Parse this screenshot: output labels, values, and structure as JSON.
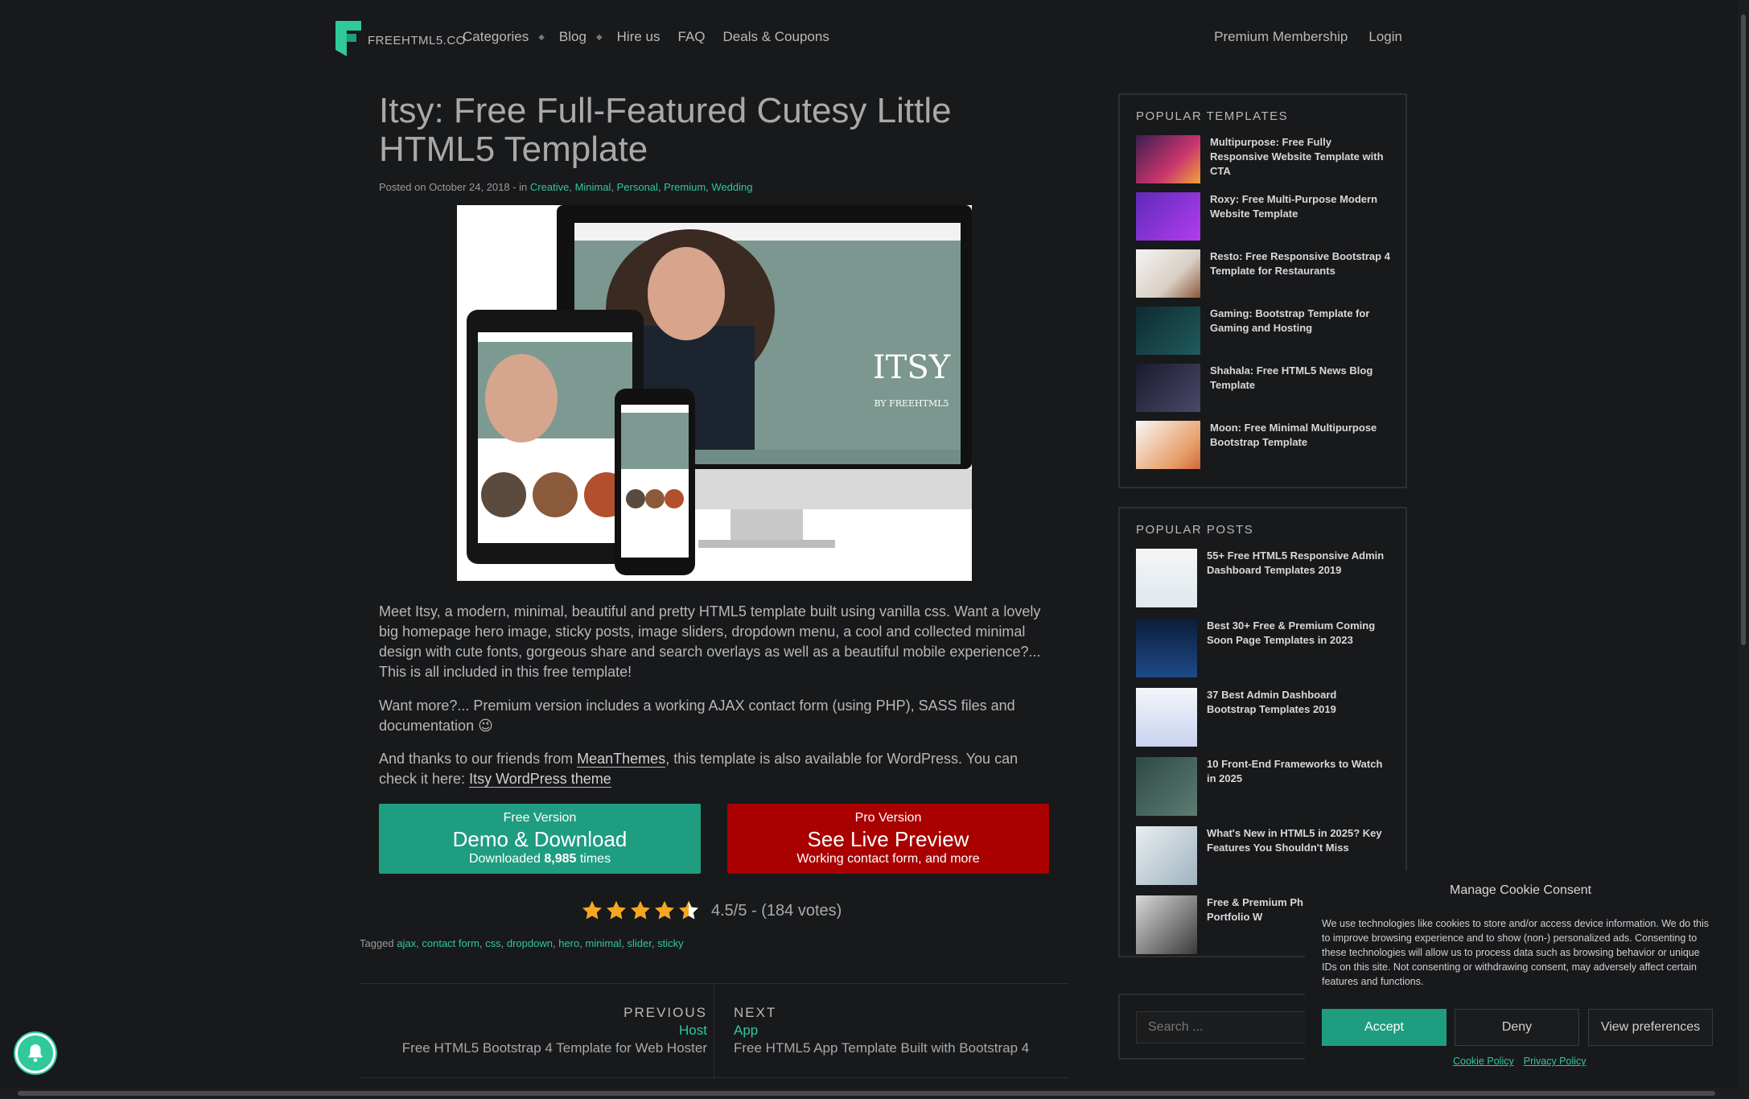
{
  "nav": {
    "logo_text": "FREEHTML5.CO",
    "links": [
      "Categories",
      "Blog",
      "Hire us",
      "FAQ",
      "Deals & Coupons"
    ],
    "right_links": [
      "Premium Membership",
      "Login"
    ]
  },
  "article": {
    "title": "Itsy: Free Full-Featured Cutesy Little HTML5 Template",
    "posted_prefix": "Posted on October 24, 2018 - in",
    "categories": [
      "Creative",
      "Minimal",
      "Personal",
      "Premium",
      "Wedding"
    ],
    "hero_brand": "ITSY",
    "hero_sub": "BY FREEHTML5",
    "p1": "Meet Itsy, a modern, minimal, beautiful and pretty HTML5 template built using vanilla css. Want a lovely big homepage hero image, sticky posts, image sliders, dropdown menu, a cool and collected minimal design with cute fonts, gorgeous share and search overlays as well as a beautiful mobile experience?... This is all included in this free template!",
    "p2": "Want more?... Premium version includes a working AJAX contact form (using PHP), SASS files and documentation 😉",
    "p3_a": "And thanks to our friends from ",
    "p3_link1": "MeanThemes",
    "p3_b": ", this template is also available for WordPress. You can check it here: ",
    "p3_link2": "Itsy WordPress theme"
  },
  "buttons": {
    "free": {
      "small": "Free Version",
      "big": "Demo & Download",
      "sub_prefix": "Downloaded ",
      "count": "8,985",
      "sub_suffix": " times"
    },
    "pro": {
      "small": "Pro Version",
      "big": "See Live Preview",
      "sub": "Working contact form, and more"
    }
  },
  "rating": {
    "stars": 4.5,
    "text": "4.5/5 - (184 votes)"
  },
  "tags": {
    "prefix": "Tagged",
    "items": [
      "ajax",
      "contact form",
      "css",
      "dropdown",
      "hero",
      "minimal",
      "slider",
      "sticky"
    ]
  },
  "post_nav": {
    "prev": {
      "label": "PREVIOUS",
      "category": "Host",
      "title": "Free HTML5 Bootstrap 4 Template for Web Hoster"
    },
    "next": {
      "label": "NEXT",
      "category": "App",
      "title": "Free HTML5 App Template Built with Bootstrap 4"
    }
  },
  "sidebar": {
    "templates_title": "POPULAR TEMPLATES",
    "templates": [
      "Multipurpose: Free Fully Responsive Website Template with CTA",
      "Roxy: Free Multi-Purpose Modern Website Template",
      "Resto: Free Responsive Bootstrap 4 Template for Restaurants",
      "Gaming: Bootstrap Template for Gaming and Hosting",
      "Shahala: Free HTML5 News Blog Template",
      "Moon: Free Minimal Multipurpose Bootstrap Template"
    ],
    "posts_title": "POPULAR POSTS",
    "posts": [
      "55+ Free HTML5 Responsive Admin Dashboard Templates 2019",
      "Best 30+ Free & Premium Coming Soon Page Templates in 2023",
      "37 Best Admin Dashboard Bootstrap Templates 2019",
      "10 Front-End Frameworks to Watch in 2025",
      "What's New in HTML5 in 2025? Key Features You Shouldn't Miss",
      "Free & Premium Ph Creative Portfolio W"
    ],
    "search_placeholder": "Search ..."
  },
  "cookie": {
    "title": "Manage Cookie Consent",
    "text": "We use technologies like cookies to store and/or access device information. We do this to improve browsing experience and to show (non-) personalized ads. Consenting to these technologies will allow us to process data such as browsing behavior or unique IDs on this site. Not consenting or withdrawing consent, may adversely affect certain features and functions.",
    "accept": "Accept",
    "deny": "Deny",
    "prefs": "View preferences",
    "cookie_policy": "Cookie Policy",
    "privacy_policy": "Privacy Policy"
  },
  "colors": {
    "accent": "#2fc99a",
    "free_button": "#1f9d80",
    "pro_button": "#a90000",
    "star": "#f5a623",
    "background": "#18191b"
  }
}
